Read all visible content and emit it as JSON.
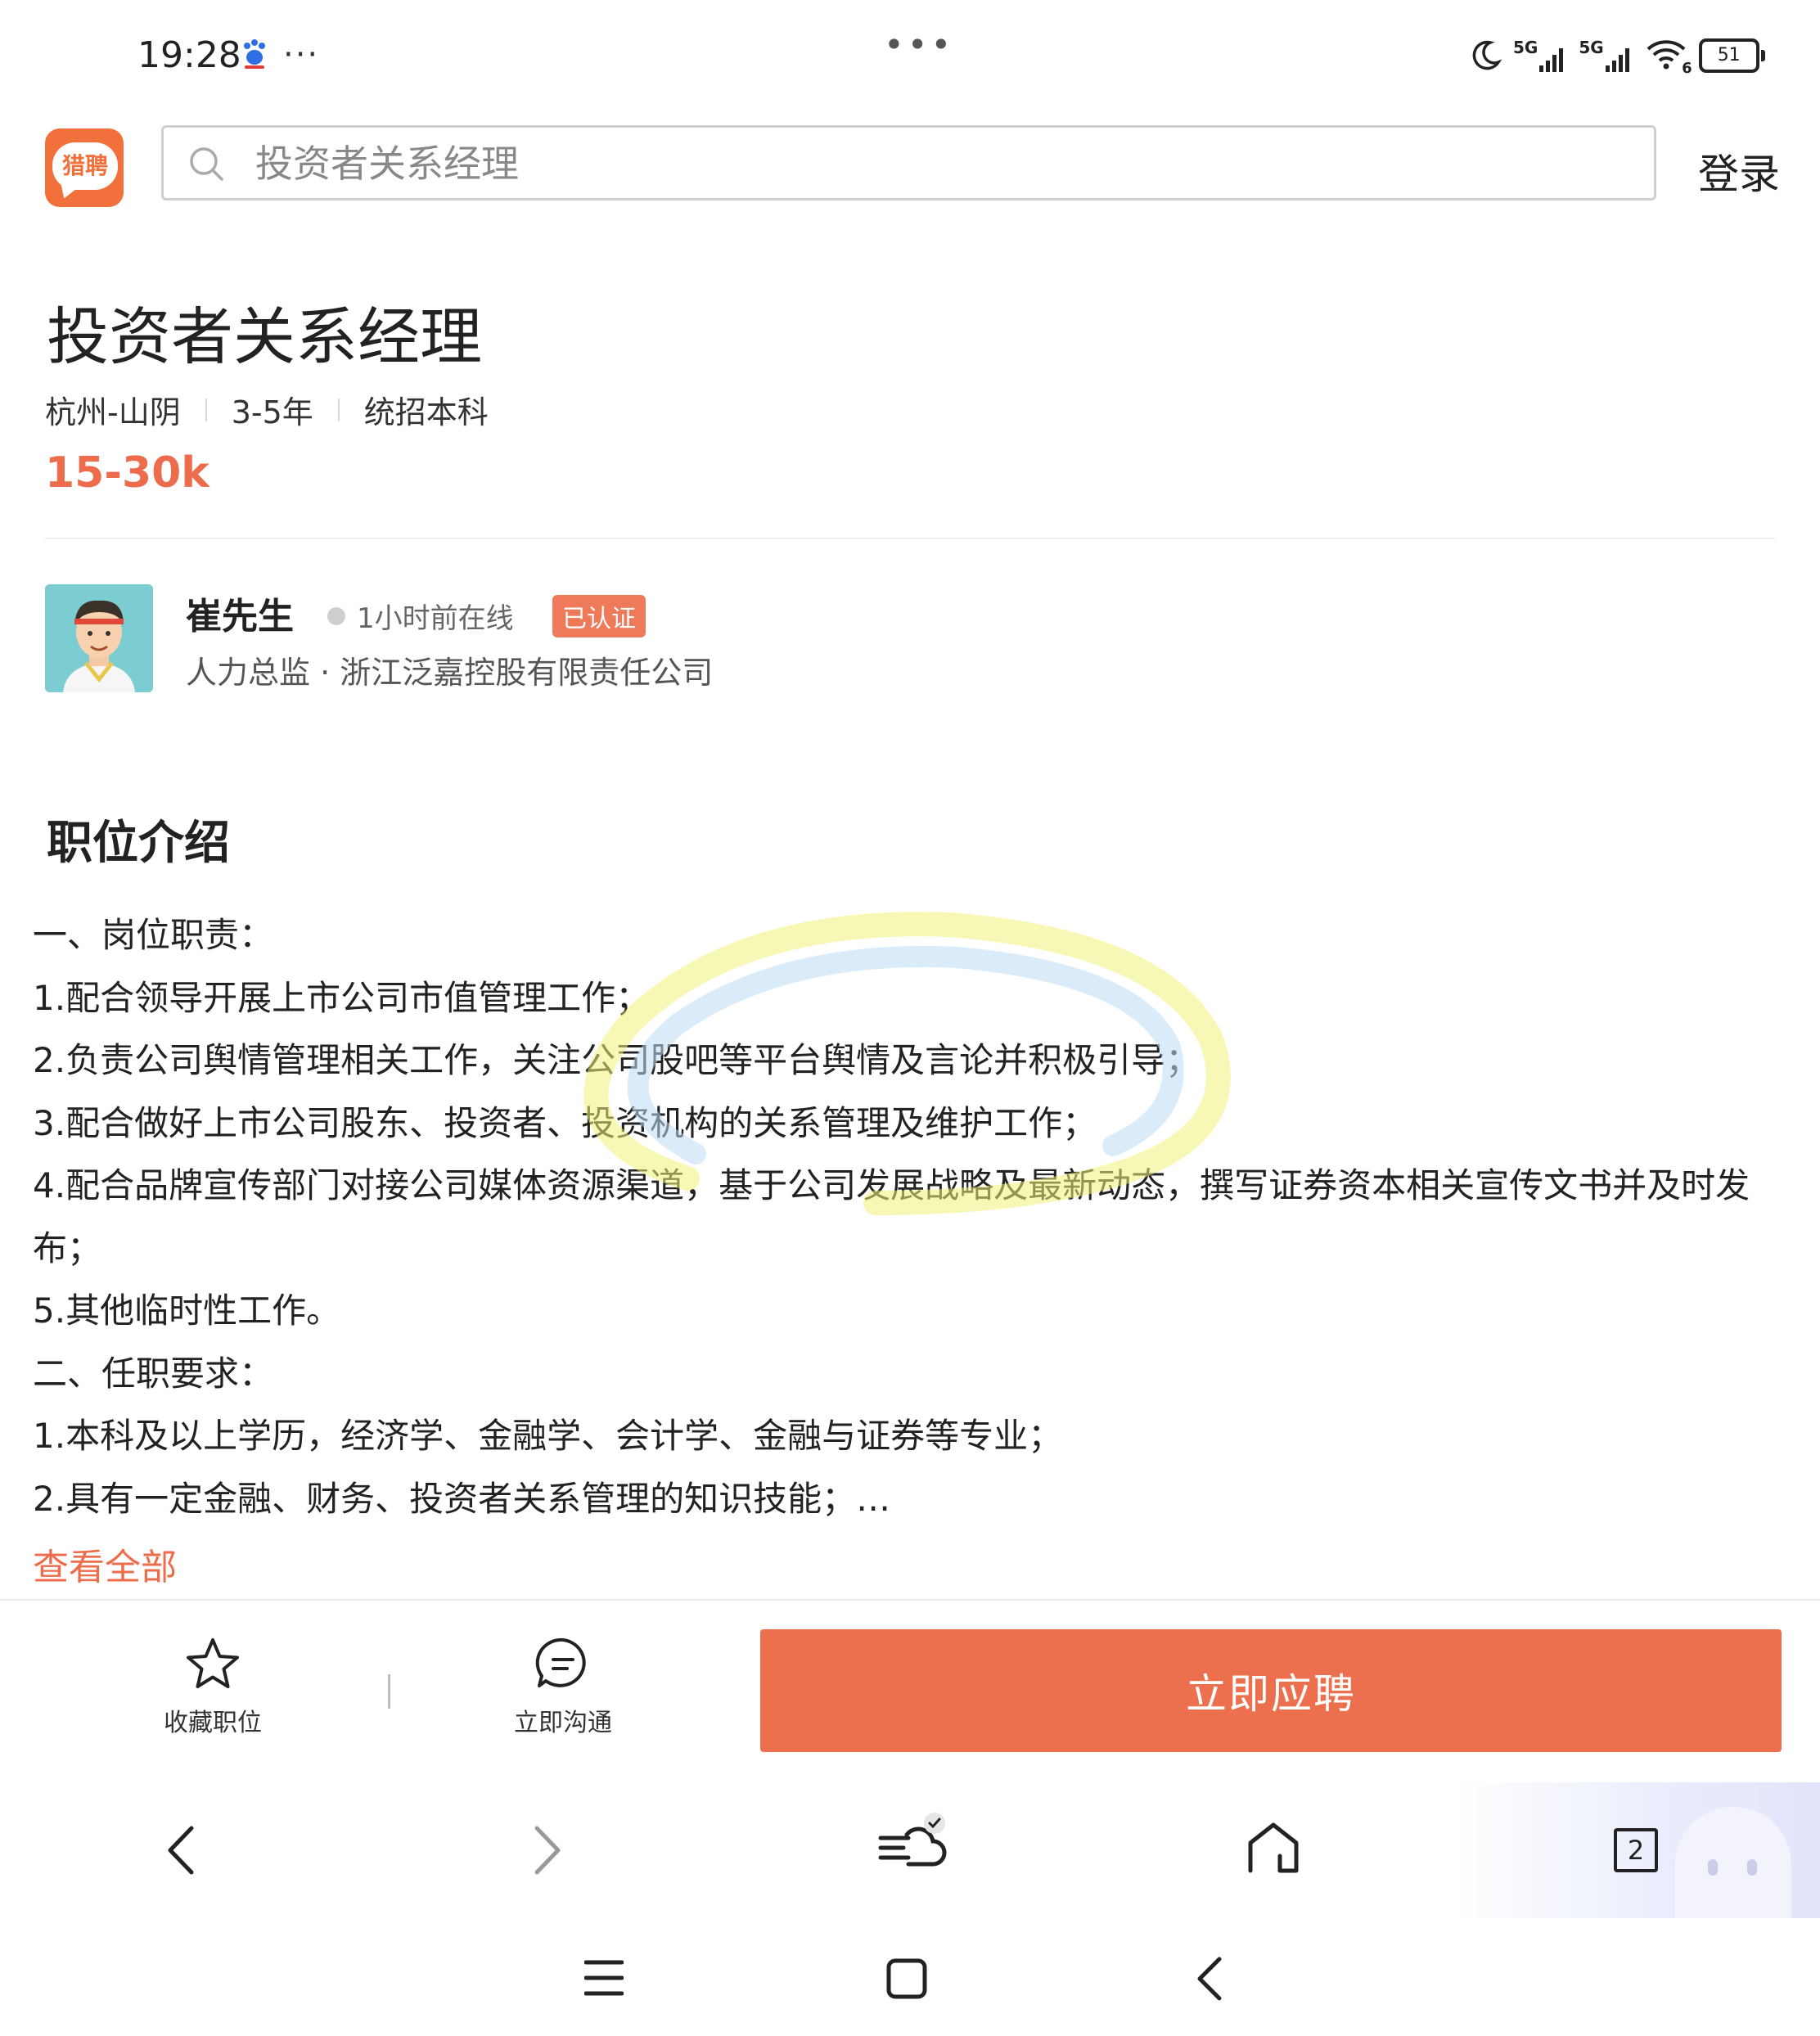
{
  "status_bar": {
    "time": "19:28",
    "left_dots": "···",
    "center_dots": "•••",
    "network_1": "5G",
    "network_2": "5G",
    "wifi_label": "6",
    "battery": "51"
  },
  "header": {
    "logo_text": "猎聘",
    "search_placeholder": "投资者关系经理",
    "login_label": "登录"
  },
  "job": {
    "title": "投资者关系经理",
    "location": "杭州-山阴",
    "experience": "3-5年",
    "education": "统招本科",
    "salary": "15-30k"
  },
  "recruiter": {
    "name": "崔先生",
    "online_status": "1小时前在线",
    "verified_badge": "已认证",
    "position_company": "人力总监 · 浙江泛嘉控股有限责任公司"
  },
  "description": {
    "heading": "职位介绍",
    "lines": [
      "一、岗位职责：",
      "1.配合领导开展上市公司市值管理工作；",
      "2.负责公司舆情管理相关工作，关注公司股吧等平台舆情及言论并积极引导；",
      "3.配合做好上市公司股东、投资者、投资机构的关系管理及维护工作；",
      "4.配合品牌宣传部门对接公司媒体资源渠道，基于公司发展战略及最新动态，撰写证券资本相关宣传文书并及时发布；",
      "5.其他临时性工作。",
      "二、任职要求：",
      "1.本科及以上学历，经济学、金融学、会计学、金融与证券等专业；",
      "2.具有一定金融、财务、投资者关系管理的知识技能；…"
    ],
    "see_all": "查看全部"
  },
  "actions": {
    "favorite_label": "收藏职位",
    "chat_label": "立即沟通",
    "apply_label": "立即应聘"
  },
  "browser_nav": {
    "tab_count": "2"
  },
  "colors": {
    "accent": "#ec6c4c",
    "apply_button": "#ec6f4e",
    "logo": "#f2703b",
    "scribble_yellow": "#f3f27a",
    "scribble_blue": "#bcdcf6"
  }
}
